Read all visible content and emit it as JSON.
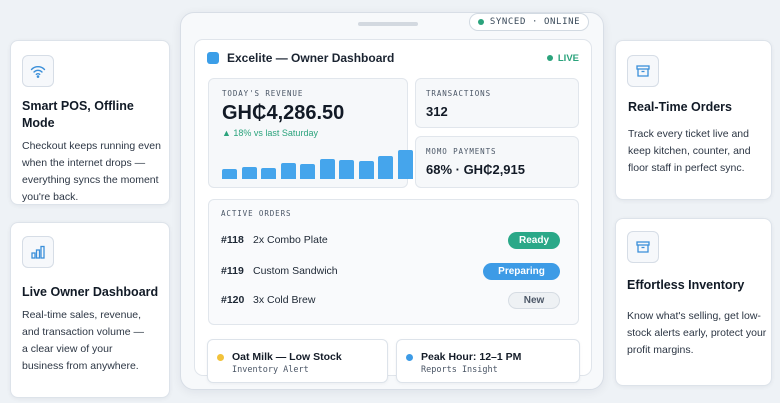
{
  "left_cards": [
    {
      "title": "Smart POS, Offline Mode",
      "text": "Checkout keeps running even when the internet drops — everything syncs the moment you're back.",
      "icon": "wifi-icon"
    },
    {
      "title": "Live Owner Dashboard",
      "text": "Real-time sales, revenue, and transaction volume — a clear view of your business from anywhere.",
      "icon": "bar-chart-icon"
    }
  ],
  "right_cards": [
    {
      "title": "Real-Time Orders",
      "text": "Track every ticket live and keep kitchen, counter, and floor staff in perfect sync.",
      "icon": "archive-box-icon"
    },
    {
      "title": "Effortless Inventory",
      "text": "Know what's selling, get low-stock alerts early, protect your profit margins.",
      "icon": "archive-box-icon"
    }
  ],
  "device": {
    "sync_status": "SYNCED · ONLINE",
    "app_title": "Excelite — Owner Dashboard",
    "live_label": "LIVE"
  },
  "revenue": {
    "label": "TODAY'S REVENUE",
    "value": "GH₵4,286.50",
    "delta": "▲ 18% vs last Saturday",
    "bar_levels": [
      0.3,
      0.36,
      0.34,
      0.5,
      0.48,
      0.62,
      0.58,
      0.55,
      0.72,
      0.9
    ]
  },
  "transactions": {
    "label": "TRANSACTIONS",
    "value": "312"
  },
  "momo": {
    "label": "MOMO PAYMENTS",
    "value": "68% · GH₵2,915"
  },
  "orders": {
    "label": "ACTIVE ORDERS",
    "rows": [
      {
        "id": "#118",
        "name": "2x Combo Plate",
        "status": "Ready"
      },
      {
        "id": "#119",
        "name": "Custom Sandwich",
        "status": "Preparing"
      },
      {
        "id": "#120",
        "name": "3x Cold Brew",
        "status": "New"
      }
    ]
  },
  "alerts": [
    {
      "title": "Oat Milk — Low Stock",
      "subtitle": "Inventory Alert",
      "color": "#f2c23a"
    },
    {
      "title": "Peak Hour: 12–1 PM",
      "subtitle": "Reports Insight",
      "color": "#3d9be6"
    }
  ],
  "colors": {
    "accent": "#3d9be6",
    "success": "#2ba37c"
  }
}
